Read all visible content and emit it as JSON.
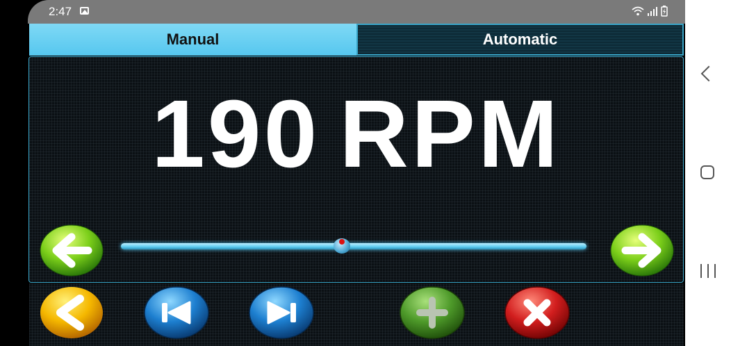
{
  "status_bar": {
    "time": "2:47",
    "icons": [
      "gallery-icon",
      "wifi-icon",
      "signal-icon",
      "battery-charging-icon"
    ]
  },
  "tabs": [
    {
      "label": "Manual",
      "selected": true
    },
    {
      "label": "Automatic",
      "selected": false
    }
  ],
  "display": {
    "rpm_value": "190",
    "rpm_unit": "RPM"
  },
  "speed_slider": {
    "level": 0.475
  },
  "controls": {
    "decrease_icon": "left-arrow-icon",
    "increase_icon": "right-arrow-icon",
    "bottom_buttons": [
      {
        "name": "back-button",
        "icon": "chevron-left-icon",
        "color": "#f5b800"
      },
      {
        "name": "previous-button",
        "icon": "skip-previous-icon",
        "color": "#1d7fd0"
      },
      {
        "name": "next-button",
        "icon": "skip-next-icon",
        "color": "#1d7fd0"
      },
      {
        "name": "add-button",
        "icon": "plus-icon",
        "color": "#4e9a2a"
      },
      {
        "name": "close-button",
        "icon": "close-icon",
        "color": "#d21e1e"
      }
    ]
  },
  "colors": {
    "accent": "#56c7ef",
    "green": "#7ccf1a",
    "background": "#0b1014"
  },
  "system_nav": [
    "back-icon",
    "home-icon",
    "recents-icon"
  ]
}
